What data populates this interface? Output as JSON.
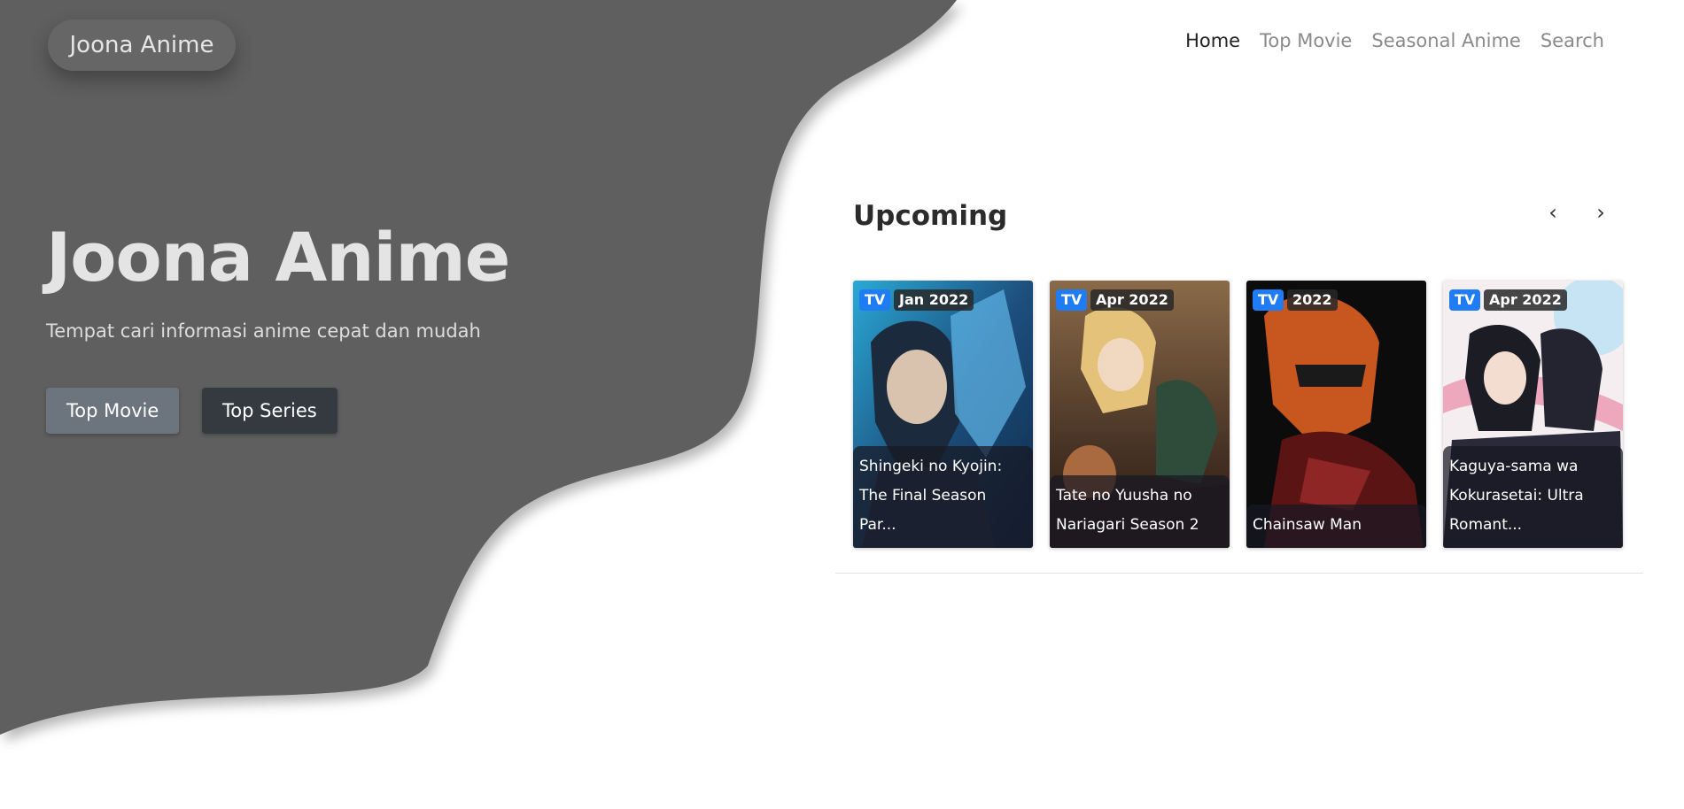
{
  "header": {
    "brand": "Joona Anime",
    "nav": [
      "Home",
      "Top Movie",
      "Seasonal Anime",
      "Search"
    ]
  },
  "hero": {
    "title": "Joona Anime",
    "subtitle": "Tempat cari informasi anime cepat dan mudah",
    "buttons": [
      "Top Movie",
      "Top Series"
    ]
  },
  "upcoming": {
    "title": "Upcoming",
    "prev_icon": "‹",
    "next_icon": "›",
    "cards": [
      {
        "type": "TV",
        "date": "Jan 2022",
        "title": "Shingeki no Kyojin: The Final Season Par..."
      },
      {
        "type": "TV",
        "date": "Apr 2022",
        "title": "Tate no Yuusha no Nariagari Season 2"
      },
      {
        "type": "TV",
        "date": "2022",
        "title": "Chainsaw Man"
      },
      {
        "type": "TV",
        "date": "Apr 2022",
        "title": "Kaguya-sama wa Kokurasetai: Ultra Romant..."
      }
    ]
  },
  "colors": {
    "hero_background": "#5f5f5f",
    "badge_type": "#1f7cf2",
    "button_secondary": "#6c757d",
    "button_dark": "#343a40"
  }
}
